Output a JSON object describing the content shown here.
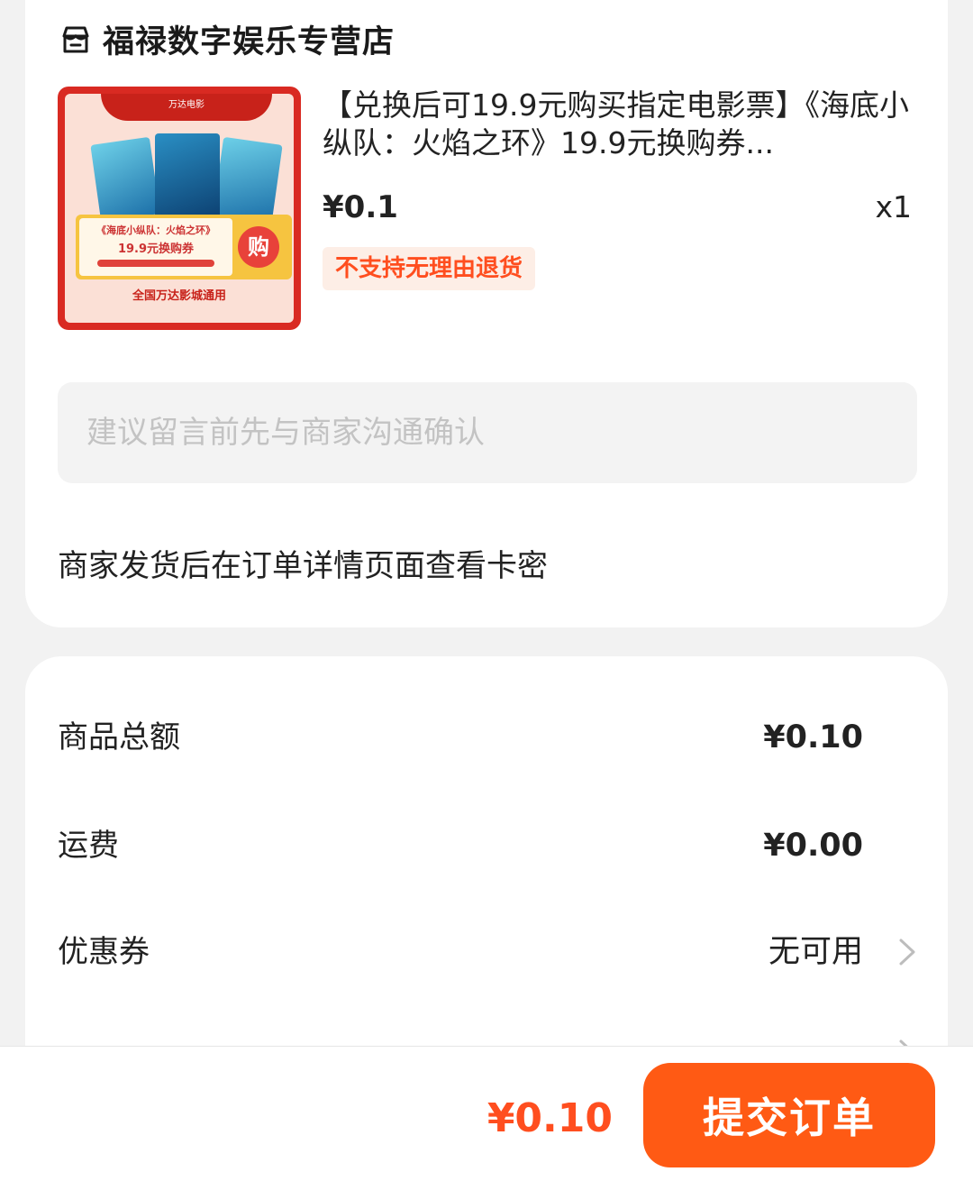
{
  "store": {
    "name": "福禄数字娱乐专营店",
    "icon": "store-icon"
  },
  "product": {
    "title": "【兑换后可19.9元购买指定电影票】《海底小纵队：火焰之环》19.9元换购券...",
    "price": "¥0.1",
    "quantity": "x1",
    "tag": "不支持无理由退货",
    "thumbnail": {
      "brand": "万达电影",
      "ticket_line1": "《海底小纵队：火焰之环》",
      "ticket_line2": "19.9元换购券",
      "buy_badge": "购",
      "footer": "全国万达影城通用"
    }
  },
  "message": {
    "placeholder": "建议留言前先与商家沟通确认",
    "value": ""
  },
  "delivery_note": "商家发货后在订单详情页面查看卡密",
  "summary": {
    "items": [
      {
        "label": "商品总额",
        "value": "¥0.10"
      },
      {
        "label": "运费",
        "value": "¥0.00"
      },
      {
        "label": "优惠券",
        "value": "无可用"
      }
    ]
  },
  "bottom_bar": {
    "total": "¥0.10",
    "submit_label": "提交订单"
  },
  "colors": {
    "accent": "#ff5a14",
    "price_red": "#ff4e1f",
    "background": "#f2f2f2"
  }
}
